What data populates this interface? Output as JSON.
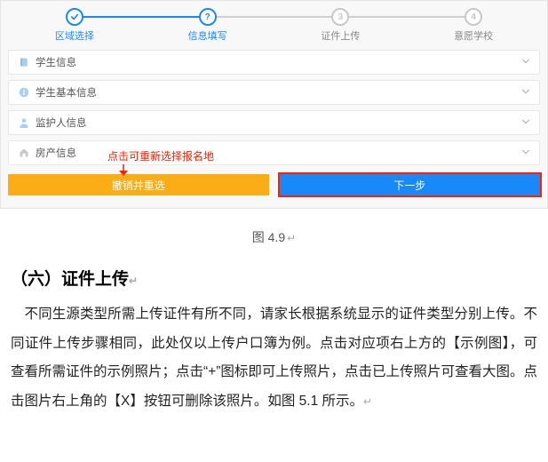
{
  "steps": [
    {
      "label": "区域选择",
      "state": "done",
      "num": ""
    },
    {
      "label": "信息填写",
      "state": "active",
      "num": ""
    },
    {
      "label": "证件上传",
      "state": "todo",
      "num": "3"
    },
    {
      "label": "意愿学校",
      "state": "todo",
      "num": "4"
    }
  ],
  "cards": [
    {
      "icon": "book-icon",
      "title": "学生信息"
    },
    {
      "icon": "info-icon",
      "title": "学生基本信息"
    },
    {
      "icon": "person-icon",
      "title": "监护人信息"
    },
    {
      "icon": "home-icon",
      "title": "房产信息"
    }
  ],
  "annotation": "点击可重新选择报名地",
  "buttons": {
    "reset": "撤销并重选",
    "next": "下一步"
  },
  "caption": "图 4.9",
  "caption_mark": "↵",
  "section_title": "（六）证件上传",
  "section_title_mark": "↵",
  "paragraph": "不同生源类型所需上传证件有所不同，请家长根据系统显示的证件类型分别上传。不同证件上传步骤相同，此处仅以上传户口簿为例。点击对应项右上方的【示例图】，可查看所需证件的示例照片；点击“+”图标即可上传照片，点击已上传照片可查看大图。点击图片右上角的【X】按钮可删除该照片。如图 5.1 所示。",
  "paragraph_end": "↵"
}
